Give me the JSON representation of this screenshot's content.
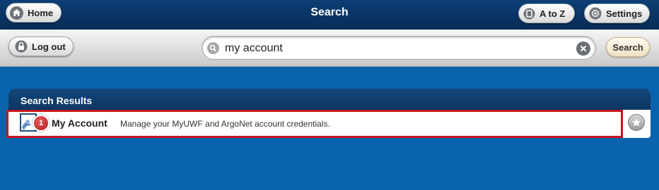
{
  "header": {
    "title": "Search",
    "home_label": "Home",
    "atoz_label": "A to Z",
    "settings_label": "Settings"
  },
  "toolbar": {
    "logout_label": "Log out",
    "search_value": "my account",
    "search_button_label": "Search"
  },
  "results": {
    "heading": "Search Results",
    "items": [
      {
        "badge": "1",
        "title": "My Account",
        "description": "Manage your MyUWF and ArgoNet account credentials."
      }
    ]
  },
  "colors": {
    "page_background": "#0a64ad",
    "header_background": "#072c57",
    "highlight_border": "#c8151d"
  }
}
